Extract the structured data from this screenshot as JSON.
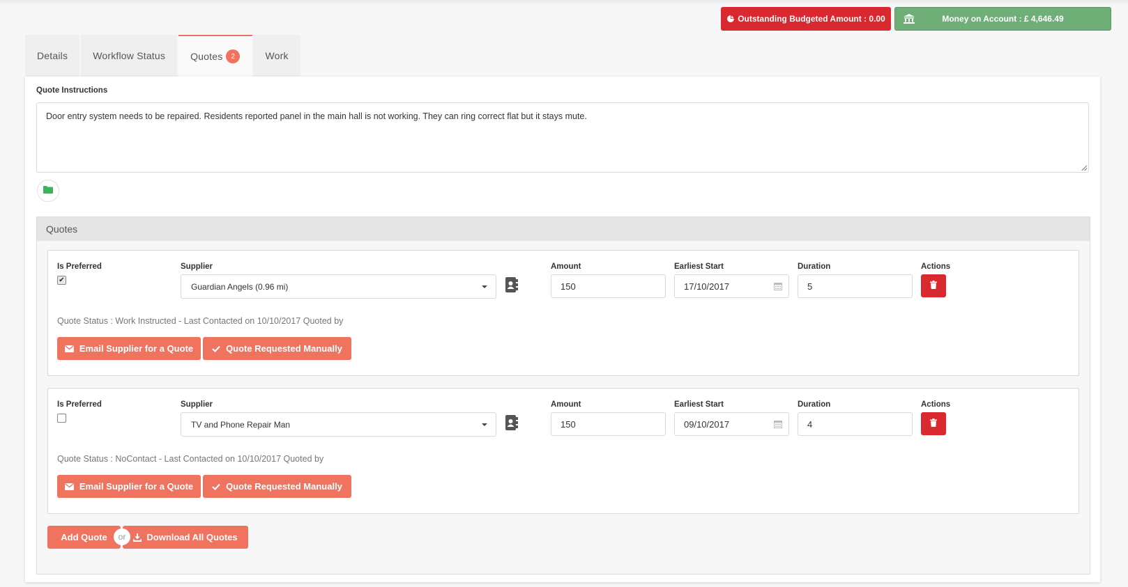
{
  "header": {
    "outstanding_label": "Outstanding Budgeted Amount : 0.00",
    "money_label": "Money on Account : £ 4,646.49"
  },
  "tabs": [
    {
      "label": "Details"
    },
    {
      "label": "Workflow Status"
    },
    {
      "label": "Quotes",
      "count": "2"
    },
    {
      "label": "Work"
    }
  ],
  "instructions": {
    "label": "Quote Instructions",
    "text": "Door entry system needs to be repaired. Residents reported panel in the main hall is not working. They can ring correct flat but it stays mute."
  },
  "quotes_section": {
    "title": "Quotes",
    "col_labels": {
      "preferred": "Is Preferred",
      "supplier": "Supplier",
      "amount": "Amount",
      "start": "Earliest Start",
      "duration": "Duration",
      "actions": "Actions"
    },
    "quotes": [
      {
        "preferred": true,
        "supplier": "Guardian Angels (0.96 mi)",
        "amount": "150",
        "start": "17/10/2017",
        "duration": "5",
        "status": "Quote Status : Work Instructed - Last Contacted on 10/10/2017 Quoted by",
        "email_label": "Email Supplier for a Quote",
        "manual_label": "Quote Requested Manually"
      },
      {
        "preferred": false,
        "supplier": "TV and Phone Repair Man",
        "amount": "150",
        "start": "09/10/2017",
        "duration": "4",
        "status": "Quote Status : NoContact - Last Contacted on 10/10/2017 Quoted by",
        "email_label": "Email Supplier for a Quote",
        "manual_label": "Quote Requested Manually"
      }
    ],
    "add_label": "Add Quote",
    "or_label": "or",
    "download_label": "Download All Quotes"
  },
  "colors": {
    "accent": "#f0735f",
    "danger": "#d9282f",
    "success": "#6fae77"
  }
}
